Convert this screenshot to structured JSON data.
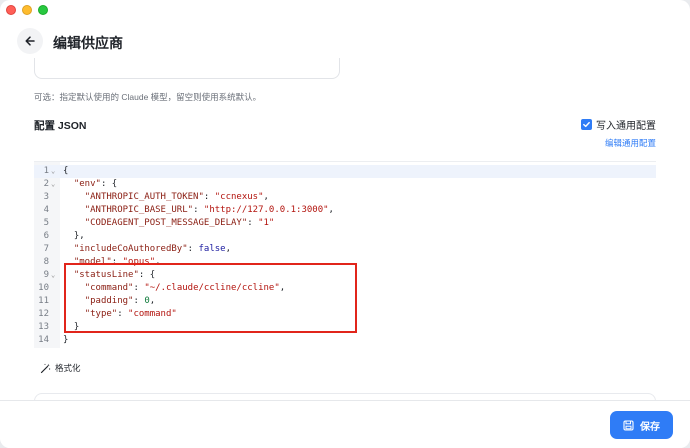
{
  "header": {
    "title": "编辑供应商"
  },
  "model": {
    "hint": "可选：指定默认使用的 Claude 模型，留空则使用系统默认。"
  },
  "config": {
    "section_title": "配置 JSON",
    "common_checkbox_label": "写入通用配置",
    "common_checkbox_checked": true,
    "edit_common_link": "编辑通用配置",
    "format_label": "格式化"
  },
  "editor": {
    "line_numbers": [
      "1",
      "2",
      "3",
      "4",
      "5",
      "6",
      "7",
      "8",
      "9",
      "10",
      "11",
      "12",
      "13",
      "14"
    ],
    "lines": [
      "{",
      "  \"env\": {",
      "    \"ANTHROPIC_AUTH_TOKEN\": \"ccnexus\",",
      "    \"ANTHROPIC_BASE_URL\": \"http://127.0.0.1:3000\",",
      "    \"CODEAGENT_POST_MESSAGE_DELAY\": \"1\"",
      "  },",
      "  \"includeCoAuthoredBy\": false,",
      "  \"model\": \"opus\",",
      "  \"statusLine\": {",
      "    \"command\": \"~/.claude/ccline/ccline\",",
      "    \"padding\": 0,",
      "    \"type\": \"command\"",
      "  }",
      "}"
    ],
    "foldable_lines": [
      "1",
      "2",
      "9"
    ]
  },
  "footer": {
    "save_label": "保存"
  },
  "colors": {
    "accent": "#2f7cf6",
    "highlight_border": "#e1251b"
  }
}
